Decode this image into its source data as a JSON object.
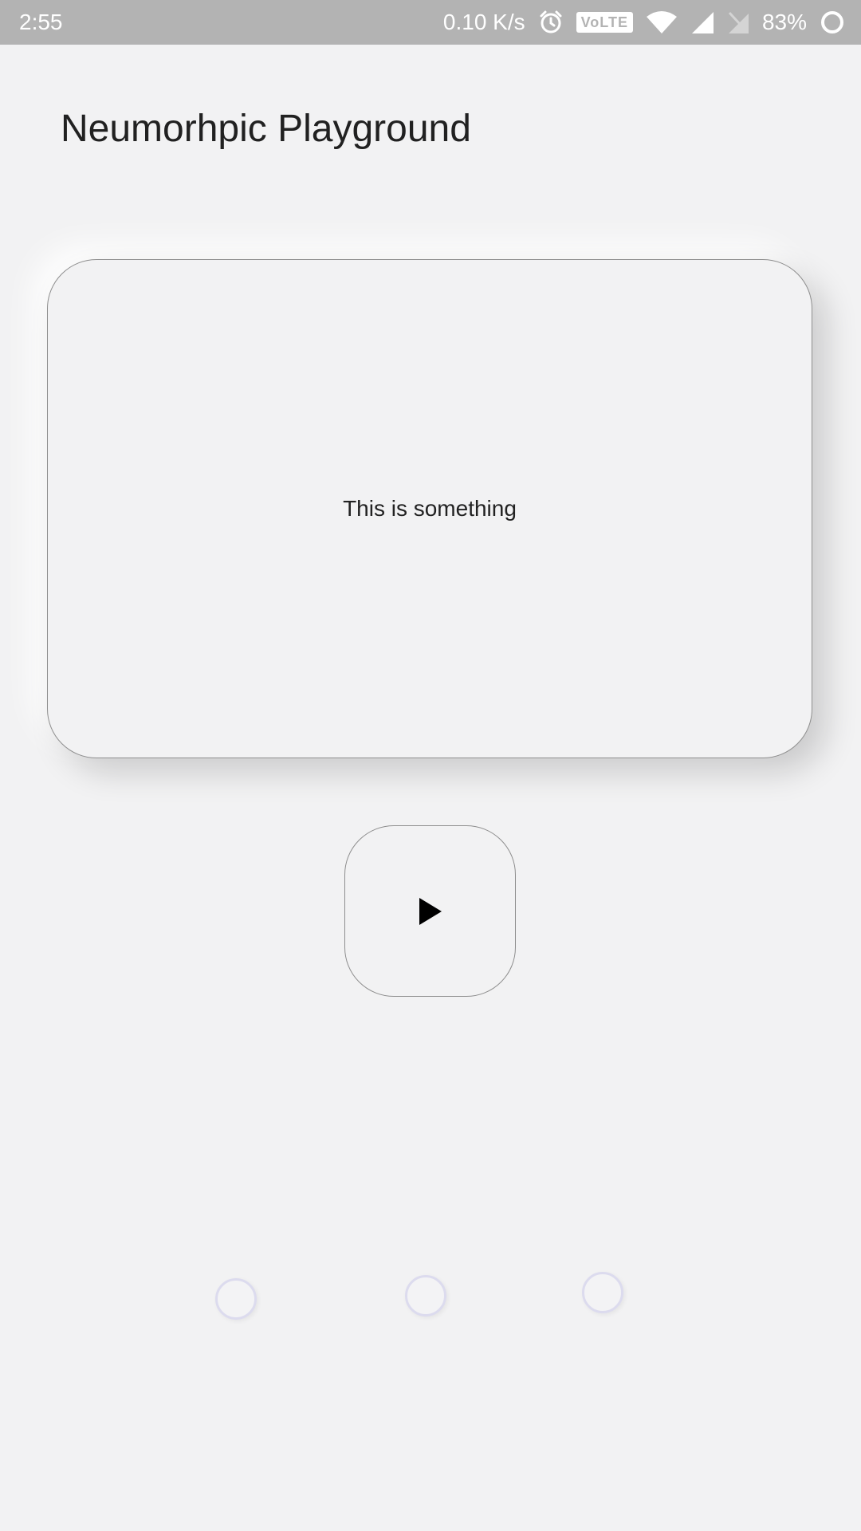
{
  "status_bar": {
    "time": "2:55",
    "net_speed": "0.10 K/s",
    "volte": "VoLTE",
    "battery_percent": "83%",
    "icons": [
      "alarm-icon",
      "volte-icon",
      "wifi-icon",
      "signal-icon",
      "no-sim-icon",
      "battery-ring-icon"
    ]
  },
  "header": {
    "title": "Neumorhpic Playground"
  },
  "card": {
    "text": "This is something"
  },
  "play_button": {
    "icon": "play-icon"
  },
  "dots": {
    "count": 3
  },
  "colors": {
    "background": "#f2f2f3",
    "status_bar": "#b3b3b3",
    "border": "#8e8e8e",
    "dot_border": "#dcdbee"
  }
}
